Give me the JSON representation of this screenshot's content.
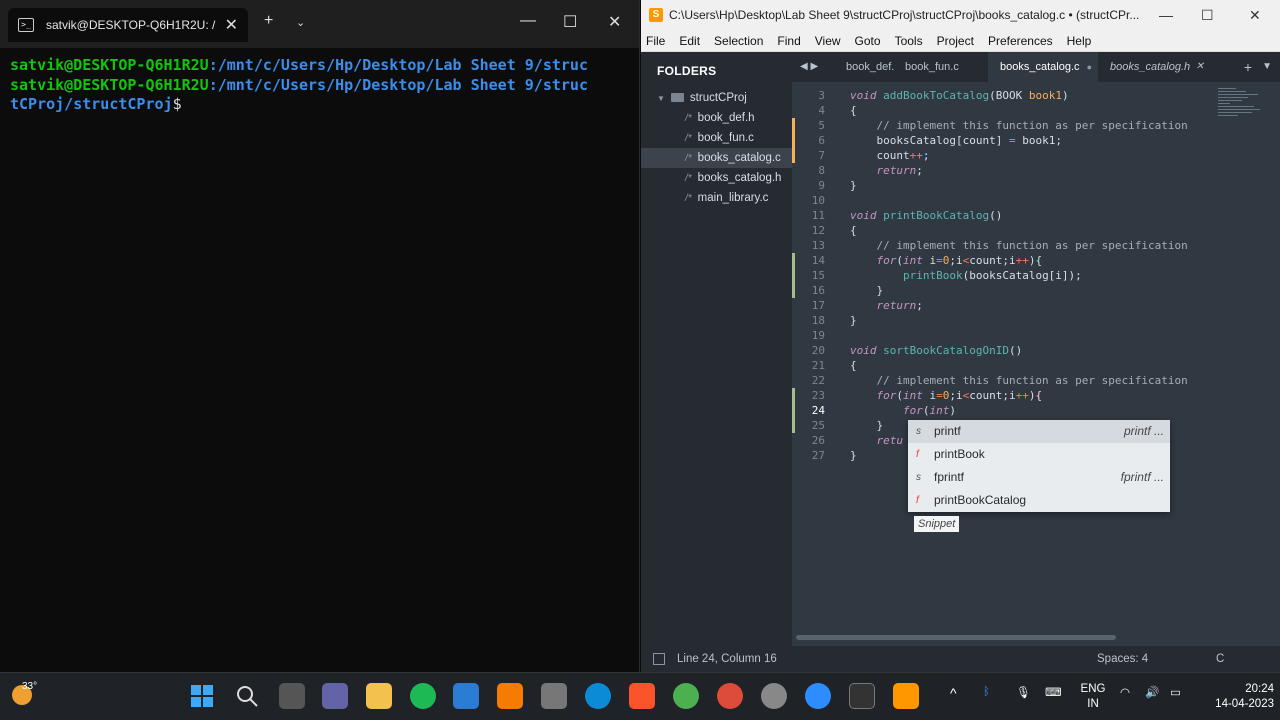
{
  "terminal": {
    "tab_title": "satvik@DESKTOP-Q6H1R2U: /",
    "user_host": "satvik@DESKTOP-Q6H1R2U",
    "line1_path": ":/mnt/c/Users/Hp/Desktop/Lab Sheet 9/struc",
    "line2_path": ":/mnt/c/Users/Hp/Desktop/Lab Sheet 9/struc",
    "line3_path": "tCProj/structCProj",
    "prompt_char": "$",
    "colors": {
      "green": "#13c40e",
      "blue": "#3b8eea"
    }
  },
  "sublime": {
    "title": "C:\\Users\\Hp\\Desktop\\Lab Sheet 9\\structCProj\\structCProj\\books_catalog.c • (structCPr...",
    "menu": [
      "File",
      "Edit",
      "Selection",
      "Find",
      "View",
      "Goto",
      "Tools",
      "Project",
      "Preferences",
      "Help"
    ],
    "sidebar": {
      "header": "FOLDERS",
      "folder": "structCProj",
      "files": [
        "book_def.h",
        "book_fun.c",
        "books_catalog.c",
        "books_catalog.h",
        "main_library.c"
      ],
      "active_index": 2
    },
    "tabs": [
      "book_def.h",
      "book_fun.c",
      "books_catalog.c",
      "books_catalog.h"
    ],
    "active_tab": 2,
    "autocomplete": {
      "items": [
        {
          "kind": "s",
          "label": "printf",
          "hint": "printf ..."
        },
        {
          "kind": "f",
          "label": "printBook",
          "hint": ""
        },
        {
          "kind": "s",
          "label": "fprintf",
          "hint": "fprintf ..."
        },
        {
          "kind": "f",
          "label": "printBookCatalog",
          "hint": ""
        }
      ],
      "footer": "Snippet"
    },
    "status": {
      "position": "Line 24, Column 16",
      "indent": "Spaces: 4",
      "syntax": "C"
    },
    "colors": {
      "bg": "#303841",
      "sidebar": "#252b31",
      "modified_bar": "#a3be8c",
      "unsaved_bar": "#f9ae58"
    }
  },
  "code_lines": [
    {
      "n": "3",
      "mod": "",
      "tokens": [
        [
          "kw",
          "void "
        ],
        [
          "fn",
          "addBookToCatalog"
        ],
        [
          "pl",
          "(BOOK "
        ],
        [
          "pa",
          "book1"
        ],
        [
          "pl",
          ")"
        ]
      ]
    },
    {
      "n": "4",
      "mod": "",
      "tokens": [
        [
          "pl",
          "{"
        ]
      ]
    },
    {
      "n": "5",
      "mod": "orange",
      "tokens": [
        [
          "cm",
          "    // implement this function as per specification"
        ]
      ]
    },
    {
      "n": "6",
      "mod": "orange",
      "tokens": [
        [
          "pl",
          "    booksCatalog[count] "
        ],
        [
          "op",
          "="
        ],
        [
          "pl",
          " book1;"
        ]
      ]
    },
    {
      "n": "7",
      "mod": "orange",
      "tokens": [
        [
          "pl",
          "    count"
        ],
        [
          "op",
          "++"
        ],
        [
          "pl",
          ";"
        ]
      ]
    },
    {
      "n": "8",
      "mod": "",
      "tokens": [
        [
          "kw",
          "    return"
        ],
        [
          "pl",
          ";"
        ]
      ]
    },
    {
      "n": "9",
      "mod": "",
      "tokens": [
        [
          "pl",
          "}"
        ]
      ]
    },
    {
      "n": "10",
      "mod": "",
      "tokens": []
    },
    {
      "n": "11",
      "mod": "",
      "tokens": [
        [
          "kw",
          "void "
        ],
        [
          "fn",
          "printBookCatalog"
        ],
        [
          "pl",
          "()"
        ]
      ]
    },
    {
      "n": "12",
      "mod": "",
      "tokens": [
        [
          "pl",
          "{"
        ]
      ]
    },
    {
      "n": "13",
      "mod": "",
      "tokens": [
        [
          "cm",
          "    // implement this function as per specification"
        ]
      ]
    },
    {
      "n": "14",
      "mod": "green",
      "tokens": [
        [
          "kw",
          "    for"
        ],
        [
          "pl",
          "("
        ],
        [
          "ty",
          "int"
        ],
        [
          "pl",
          " i"
        ],
        [
          "op",
          "="
        ],
        [
          "nm",
          "0"
        ],
        [
          "pl",
          ";i"
        ],
        [
          "op",
          "<"
        ],
        [
          "pl",
          "count;i"
        ],
        [
          "op",
          "++"
        ],
        [
          "pl",
          "){"
        ]
      ]
    },
    {
      "n": "15",
      "mod": "green",
      "tokens": [
        [
          "fn",
          "        printBook"
        ],
        [
          "pl",
          "(booksCatalog[i]);"
        ]
      ]
    },
    {
      "n": "16",
      "mod": "green",
      "tokens": [
        [
          "pl",
          "    }"
        ]
      ]
    },
    {
      "n": "17",
      "mod": "",
      "tokens": [
        [
          "kw",
          "    return"
        ],
        [
          "pl",
          ";"
        ]
      ]
    },
    {
      "n": "18",
      "mod": "",
      "tokens": [
        [
          "pl",
          "}"
        ]
      ]
    },
    {
      "n": "19",
      "mod": "",
      "tokens": []
    },
    {
      "n": "20",
      "mod": "",
      "tokens": [
        [
          "kw",
          "void "
        ],
        [
          "fn",
          "sortBookCatalogOnID"
        ],
        [
          "pl",
          "()"
        ]
      ]
    },
    {
      "n": "21",
      "mod": "",
      "tokens": [
        [
          "pl",
          "{"
        ]
      ]
    },
    {
      "n": "22",
      "mod": "",
      "tokens": [
        [
          "cm",
          "    // implement this function as per specification"
        ]
      ]
    },
    {
      "n": "23",
      "mod": "green",
      "tokens": [
        [
          "kw",
          "    for"
        ],
        [
          "pl",
          "("
        ],
        [
          "ty",
          "int"
        ],
        [
          "pl",
          " i"
        ],
        [
          "op",
          "="
        ],
        [
          "nm",
          "0"
        ],
        [
          "pl",
          ";i"
        ],
        [
          "op",
          "<"
        ],
        [
          "pl",
          "count;i"
        ],
        [
          "op",
          "++"
        ],
        [
          "pl",
          "){"
        ]
      ]
    },
    {
      "n": "24",
      "mod": "green",
      "tokens": [
        [
          "kw",
          "        for"
        ],
        [
          "pl",
          "("
        ],
        [
          "ty",
          "int"
        ],
        [
          "pl",
          ")"
        ]
      ]
    },
    {
      "n": "25",
      "mod": "green",
      "tokens": [
        [
          "pl",
          "    }"
        ]
      ]
    },
    {
      "n": "26",
      "mod": "",
      "tokens": [
        [
          "kw",
          "    retu"
        ]
      ]
    },
    {
      "n": "27",
      "mod": "",
      "tokens": [
        [
          "pl",
          "}"
        ]
      ]
    }
  ],
  "current_line": "24",
  "taskbar": {
    "weather": "33°",
    "lang1": "ENG",
    "lang2": "IN",
    "time": "20:24",
    "date": "14-04-2023"
  }
}
